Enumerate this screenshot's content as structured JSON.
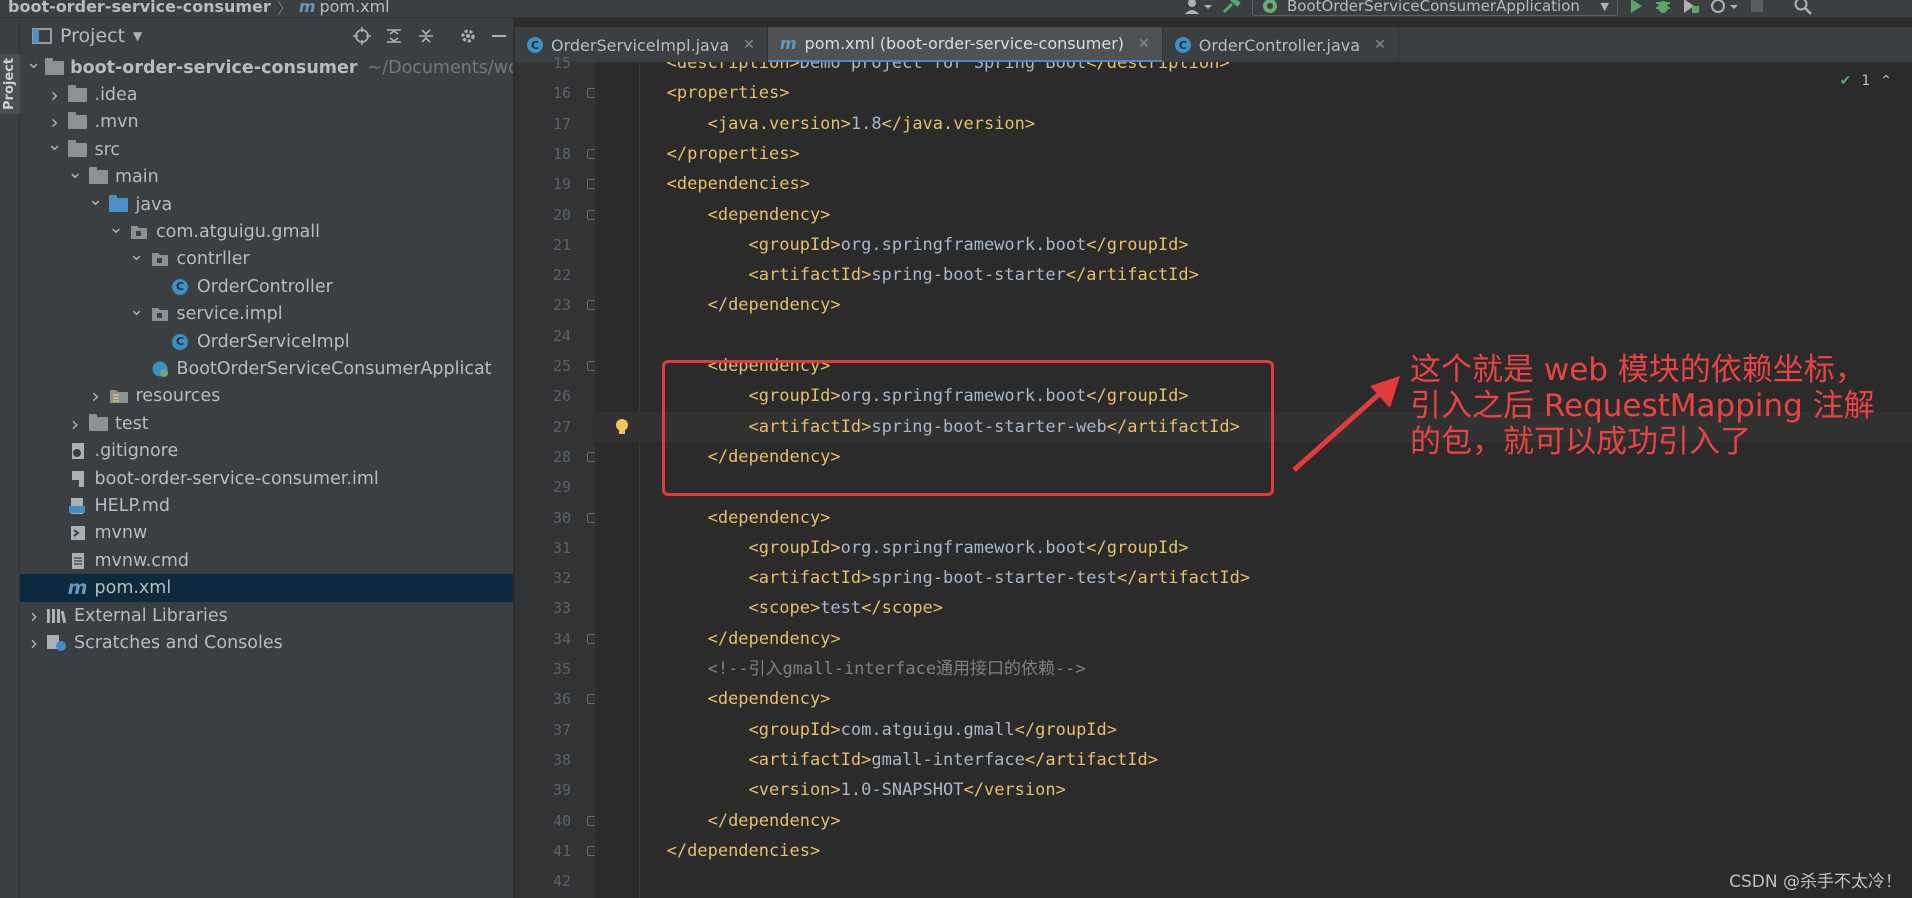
{
  "breadcrumb": {
    "project": "boot-order-service-consumer",
    "file_prefix": "m",
    "file": "pom.xml"
  },
  "run_config": {
    "name": "BootOrderServiceConsumerApplication"
  },
  "project_panel": {
    "title": "Project",
    "tree": [
      {
        "label": "boot-order-service-consumer",
        "path": "~/Documents/wo",
        "depth": 0,
        "arrow": "open",
        "icon": "module-folder-icon",
        "bold": true
      },
      {
        "label": ".idea",
        "depth": 1,
        "arrow": "closed",
        "icon": "folder-icon"
      },
      {
        "label": ".mvn",
        "depth": 1,
        "arrow": "closed",
        "icon": "folder-icon"
      },
      {
        "label": "src",
        "depth": 1,
        "arrow": "open",
        "icon": "folder-icon"
      },
      {
        "label": "main",
        "depth": 2,
        "arrow": "open",
        "icon": "folder-icon"
      },
      {
        "label": "java",
        "depth": 3,
        "arrow": "open",
        "icon": "source-folder-icon"
      },
      {
        "label": "com.atguigu.gmall",
        "depth": 4,
        "arrow": "open",
        "icon": "package-icon"
      },
      {
        "label": "contrller",
        "depth": 5,
        "arrow": "open",
        "icon": "package-icon"
      },
      {
        "label": "OrderController",
        "depth": 6,
        "arrow": "none",
        "icon": "class-icon"
      },
      {
        "label": "service.impl",
        "depth": 5,
        "arrow": "open",
        "icon": "package-icon"
      },
      {
        "label": "OrderServiceImpl",
        "depth": 6,
        "arrow": "none",
        "icon": "class-icon"
      },
      {
        "label": "BootOrderServiceConsumerApplicat",
        "depth": 5,
        "arrow": "none",
        "icon": "spring-boot-class-icon"
      },
      {
        "label": "resources",
        "depth": 3,
        "arrow": "closed",
        "icon": "resources-folder-icon"
      },
      {
        "label": "test",
        "depth": 2,
        "arrow": "closed",
        "icon": "folder-icon"
      },
      {
        "label": ".gitignore",
        "depth": 1,
        "arrow": "none",
        "icon": "gitignore-file-icon"
      },
      {
        "label": "boot-order-service-consumer.iml",
        "depth": 1,
        "arrow": "none",
        "icon": "iml-file-icon"
      },
      {
        "label": "HELP.md",
        "depth": 1,
        "arrow": "none",
        "icon": "markdown-file-icon"
      },
      {
        "label": "mvnw",
        "depth": 1,
        "arrow": "none",
        "icon": "shell-file-icon"
      },
      {
        "label": "mvnw.cmd",
        "depth": 1,
        "arrow": "none",
        "icon": "text-file-icon"
      },
      {
        "label": "pom.xml",
        "depth": 1,
        "arrow": "none",
        "icon": "maven-file-icon",
        "selected": true
      },
      {
        "label": "External Libraries",
        "depth": 0,
        "arrow": "closed",
        "icon": "libraries-icon"
      },
      {
        "label": "Scratches and Consoles",
        "depth": 0,
        "arrow": "closed",
        "icon": "scratches-icon"
      }
    ]
  },
  "tabs": [
    {
      "label": "OrderServiceImpl.java",
      "icon": "class-icon"
    },
    {
      "label": "pom.xml (boot-order-service-consumer)",
      "icon": "maven-file-icon",
      "active": true
    },
    {
      "label": "OrderController.java",
      "icon": "class-icon"
    }
  ],
  "inspection": {
    "count": "1"
  },
  "editor": {
    "lines": [
      {
        "n": "15",
        "indent": 1,
        "text": "<description>Demo project for Spring Boot</description>"
      },
      {
        "n": "16",
        "indent": 1,
        "text": "<properties>"
      },
      {
        "n": "17",
        "indent": 2,
        "text": "<java.version>1.8</java.version>"
      },
      {
        "n": "18",
        "indent": 1,
        "text": "</properties>"
      },
      {
        "n": "19",
        "indent": 1,
        "text": "<dependencies>"
      },
      {
        "n": "20",
        "indent": 2,
        "text": "<dependency>"
      },
      {
        "n": "21",
        "indent": 3,
        "text": "<groupId>org.springframework.boot</groupId>"
      },
      {
        "n": "22",
        "indent": 3,
        "text": "<artifactId>spring-boot-starter</artifactId>"
      },
      {
        "n": "23",
        "indent": 2,
        "text": "</dependency>"
      },
      {
        "n": "24",
        "indent": 0,
        "text": ""
      },
      {
        "n": "25",
        "indent": 2,
        "text": "<dependency>"
      },
      {
        "n": "26",
        "indent": 3,
        "text": "<groupId>org.springframework.boot</groupId>"
      },
      {
        "n": "27",
        "indent": 3,
        "text": "<artifactId>spring-boot-starter-web</artifactId>",
        "current": true
      },
      {
        "n": "28",
        "indent": 2,
        "text": "</dependency>"
      },
      {
        "n": "29",
        "indent": 0,
        "text": ""
      },
      {
        "n": "30",
        "indent": 2,
        "text": "<dependency>"
      },
      {
        "n": "31",
        "indent": 3,
        "text": "<groupId>org.springframework.boot</groupId>"
      },
      {
        "n": "32",
        "indent": 3,
        "text": "<artifactId>spring-boot-starter-test</artifactId>"
      },
      {
        "n": "33",
        "indent": 3,
        "text": "<scope>test</scope>"
      },
      {
        "n": "34",
        "indent": 2,
        "text": "</dependency>"
      },
      {
        "n": "35",
        "indent": 2,
        "text": "<!--引入gmall-interface通用接口的依赖-->",
        "comment": true
      },
      {
        "n": "36",
        "indent": 2,
        "text": "<dependency>"
      },
      {
        "n": "37",
        "indent": 3,
        "text": "<groupId>com.atguigu.gmall</groupId>"
      },
      {
        "n": "38",
        "indent": 3,
        "text": "<artifactId>gmall-interface</artifactId>"
      },
      {
        "n": "39",
        "indent": 3,
        "text": "<version>1.0-SNAPSHOT</version>"
      },
      {
        "n": "40",
        "indent": 2,
        "text": "</dependency>"
      },
      {
        "n": "41",
        "indent": 1,
        "text": "</dependencies>"
      },
      {
        "n": "42",
        "indent": 0,
        "text": ""
      }
    ]
  },
  "annotation": {
    "text": "这个就是 web 模块的依赖坐标，引入之后 RequestMapping 注解的包，就可以成功引入了",
    "color": "#e94343"
  },
  "watermark": "CSDN @杀手不太冷！",
  "colors": {
    "accent": "#4a88c7",
    "tag": "#e8bf6a",
    "text": "#a9b7c6",
    "comment": "#808080"
  }
}
